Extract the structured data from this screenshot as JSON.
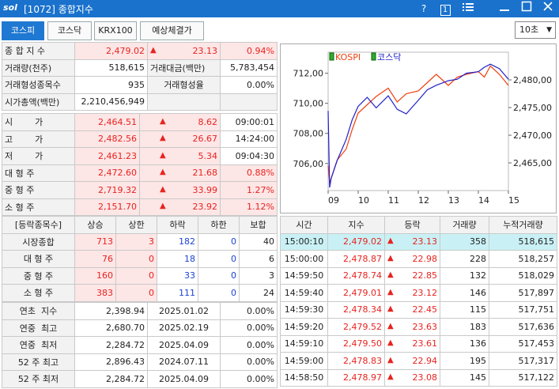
{
  "window": {
    "logo": "sol",
    "title": "[1072] 종합지수",
    "help": "?",
    "page_num": "1",
    "menu_icon": "menu-icon",
    "minimize_icon": "minimize-icon",
    "maximize_icon": "maximize-icon",
    "close_icon": "close-icon"
  },
  "tabs": [
    "코스피",
    "코스닥",
    "KRX100",
    "예상체결가"
  ],
  "interval": "10초",
  "summary": {
    "row1": {
      "label": "종 합 지 수",
      "value": "2,479.02",
      "change": "23.13",
      "pct": "0.94%"
    },
    "row2": {
      "label1": "거래량(천주)",
      "value1": "518,615",
      "label2": "거래대금(백만)",
      "value2": "5,783,454"
    },
    "row3": {
      "label1": "거래형성종목수",
      "value1": "935",
      "label2": "거래형성율",
      "value2": "0.00%"
    },
    "row4": {
      "label1": "시가총액(백만)",
      "value1": "2,210,456,949"
    }
  },
  "prices": [
    {
      "label": "시        가",
      "value": "2,464.51",
      "change": "8.62",
      "extra": "09:00:01"
    },
    {
      "label": "고        가",
      "value": "2,482.56",
      "change": "26.67",
      "extra": "14:24:00"
    },
    {
      "label": "저        가",
      "value": "2,461.23",
      "change": "5.34",
      "extra": "09:04:30"
    },
    {
      "label": "대 형 주",
      "value": "2,472.60",
      "change": "21.68",
      "extra": "0.88%"
    },
    {
      "label": "중 형 주",
      "value": "2,719.32",
      "change": "33.99",
      "extra": "1.27%"
    },
    {
      "label": "소 형 주",
      "value": "2,151.70",
      "change": "23.92",
      "extra": "1.12%"
    }
  ],
  "breadth": {
    "headers": [
      "[등락종목수]",
      "상승",
      "상한",
      "하락",
      "하한",
      "보합"
    ],
    "rows": [
      {
        "label": "시장종합",
        "up": "713",
        "uplimit": "3",
        "down": "182",
        "downlimit": "0",
        "flat": "40"
      },
      {
        "label": "대 형 주",
        "up": "76",
        "uplimit": "0",
        "down": "18",
        "downlimit": "0",
        "flat": "6"
      },
      {
        "label": "중 형 주",
        "up": "160",
        "uplimit": "0",
        "down": "33",
        "downlimit": "0",
        "flat": "3"
      },
      {
        "label": "소 형 주",
        "up": "383",
        "uplimit": "0",
        "down": "111",
        "downlimit": "0",
        "flat": "24"
      }
    ]
  },
  "yearly": [
    {
      "label": "연초  지수",
      "value": "2,398.94",
      "date": "2025.01.02",
      "pct": "0.00%"
    },
    {
      "label": "연중  최고",
      "value": "2,680.70",
      "date": "2025.02.19",
      "pct": "0.00%"
    },
    {
      "label": "연중  최저",
      "value": "2,284.72",
      "date": "2025.04.09",
      "pct": "0.00%"
    },
    {
      "label": "52 주 최고",
      "value": "2,896.43",
      "date": "2024.07.11",
      "pct": "0.00%"
    },
    {
      "label": "52 주 최저",
      "value": "2,284.72",
      "date": "2025.04.09",
      "pct": "0.00%"
    }
  ],
  "ticks": {
    "headers": [
      "시간",
      "지수",
      "등락",
      "거래량",
      "누적거래량"
    ],
    "rows": [
      {
        "time": "15:00:10",
        "index": "2,479.02",
        "change": "23.13",
        "volume": "358",
        "cum": "518,615"
      },
      {
        "time": "15:00:00",
        "index": "2,478.87",
        "change": "22.98",
        "volume": "228",
        "cum": "518,257"
      },
      {
        "time": "14:59:50",
        "index": "2,478.74",
        "change": "22.85",
        "volume": "132",
        "cum": "518,029"
      },
      {
        "time": "14:59:40",
        "index": "2,479.01",
        "change": "23.12",
        "volume": "146",
        "cum": "517,897"
      },
      {
        "time": "14:59:30",
        "index": "2,478.34",
        "change": "22.45",
        "volume": "115",
        "cum": "517,751"
      },
      {
        "time": "14:59:20",
        "index": "2,479.52",
        "change": "23.63",
        "volume": "183",
        "cum": "517,636"
      },
      {
        "time": "14:59:10",
        "index": "2,479.50",
        "change": "23.61",
        "volume": "136",
        "cum": "517,453"
      },
      {
        "time": "14:59:00",
        "index": "2,478.83",
        "change": "22.94",
        "volume": "195",
        "cum": "517,317"
      },
      {
        "time": "14:58:50",
        "index": "2,478.97",
        "change": "23.08",
        "volume": "145",
        "cum": "517,122"
      }
    ]
  },
  "chart_data": {
    "type": "line",
    "legend": [
      "KOSPI",
      "코스닥"
    ],
    "colors": {
      "KOSPI": "#f04010",
      "코스닥": "#2020c8"
    },
    "x_ticks": [
      "09",
      "10",
      "11",
      "12",
      "13",
      "14",
      "15"
    ],
    "left_ticks": [
      "712,00",
      "710,00",
      "708,00",
      "706,00"
    ],
    "right_ticks": [
      "2,480,00",
      "2,475,00",
      "2,470,00",
      "2,465,00"
    ],
    "left_range": [
      704.2,
      713.4
    ],
    "right_range": [
      2460.0,
      2485.0
    ],
    "series": [
      {
        "name": "KOSPI",
        "axis": "right",
        "x": [
          9.0,
          9.05,
          9.1,
          9.3,
          9.6,
          9.8,
          10.0,
          10.3,
          10.6,
          11.0,
          11.3,
          11.6,
          12.0,
          12.3,
          12.6,
          13.0,
          13.3,
          13.6,
          14.0,
          14.2,
          14.4,
          14.7,
          15.0
        ],
        "y": [
          2464.5,
          2461.3,
          2462.2,
          2465.5,
          2467.5,
          2471.0,
          2474.0,
          2475.5,
          2477.0,
          2478.5,
          2476.0,
          2477.5,
          2478.0,
          2479.5,
          2481.0,
          2479.0,
          2480.5,
          2481.0,
          2481.5,
          2480.5,
          2482.5,
          2481.0,
          2479.0
        ]
      },
      {
        "name": "코스닥",
        "axis": "left",
        "x": [
          9.0,
          9.05,
          9.1,
          9.3,
          9.6,
          9.8,
          10.0,
          10.3,
          10.6,
          11.0,
          11.3,
          11.6,
          12.0,
          12.3,
          12.6,
          13.0,
          13.3,
          13.6,
          14.0,
          14.2,
          14.4,
          14.7,
          15.0
        ],
        "y": [
          709.5,
          704.4,
          705.0,
          706.2,
          707.6,
          708.9,
          709.8,
          710.4,
          709.7,
          710.5,
          709.6,
          709.3,
          710.2,
          710.9,
          711.2,
          711.5,
          711.6,
          712.0,
          712.1,
          712.4,
          712.6,
          712.3,
          711.6
        ]
      }
    ]
  }
}
